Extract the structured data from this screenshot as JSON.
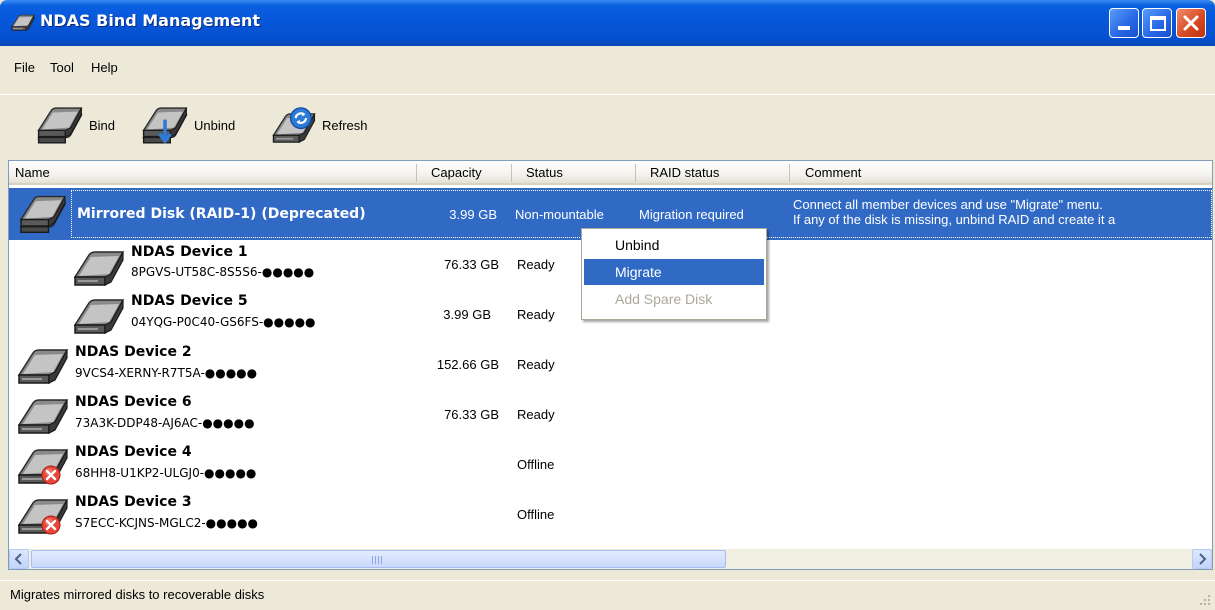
{
  "window": {
    "title": "NDAS Bind Management"
  },
  "menu": {
    "file": "File",
    "tool": "Tool",
    "help": "Help"
  },
  "toolbar": {
    "bind": "Bind",
    "unbind": "Unbind",
    "refresh": "Refresh"
  },
  "columns": {
    "name": "Name",
    "capacity": "Capacity",
    "status": "Status",
    "raid_status": "RAID status",
    "comment": "Comment"
  },
  "rows": [
    {
      "name": "Mirrored Disk (RAID-1) (Deprecated)",
      "capacity": "3.99 GB",
      "status": "Non-mountable",
      "raid_status": "Migration required",
      "comment_line1": "Connect all member devices and use \"Migrate\" menu.",
      "comment_line2": "If any of the disk is missing, unbind RAID and create it a"
    },
    {
      "name": "NDAS Device 1",
      "id": "8PGVS-UT58C-8S5S6-●●●●●",
      "capacity": "76.33 GB",
      "status": "Ready"
    },
    {
      "name": "NDAS Device 5",
      "id": "04YQG-P0C40-GS6FS-●●●●●",
      "capacity": "3.99 GB",
      "status": "Ready"
    },
    {
      "name": "NDAS Device 2",
      "id": "9VCS4-XERNY-R7T5A-●●●●●",
      "capacity": "152.66 GB",
      "status": "Ready"
    },
    {
      "name": "NDAS Device 6",
      "id": "73A3K-DDP48-AJ6AC-●●●●●",
      "capacity": "76.33 GB",
      "status": "Ready"
    },
    {
      "name": "NDAS Device 4",
      "id": "68HH8-U1KP2-ULGJ0-●●●●●",
      "capacity": "",
      "status": "Offline"
    },
    {
      "name": "NDAS Device 3",
      "id": "S7ECC-KCJNS-MGLC2-●●●●●",
      "capacity": "",
      "status": "Offline"
    }
  ],
  "context_menu": {
    "unbind": "Unbind",
    "migrate": "Migrate",
    "add_spare": "Add Spare Disk"
  },
  "statusbar": {
    "text": "Migrates mirrored disks to recoverable disks"
  },
  "colors": {
    "selection": "#316AC5",
    "titlebar": "#0656D8",
    "window_bg": "#ECE9D8"
  },
  "icons": {
    "disk": "hard-disk-icon",
    "offline_badge": "error-x-icon",
    "bind": "bind-disks-icon",
    "unbind": "unbind-disks-icon",
    "refresh": "refresh-icon"
  }
}
